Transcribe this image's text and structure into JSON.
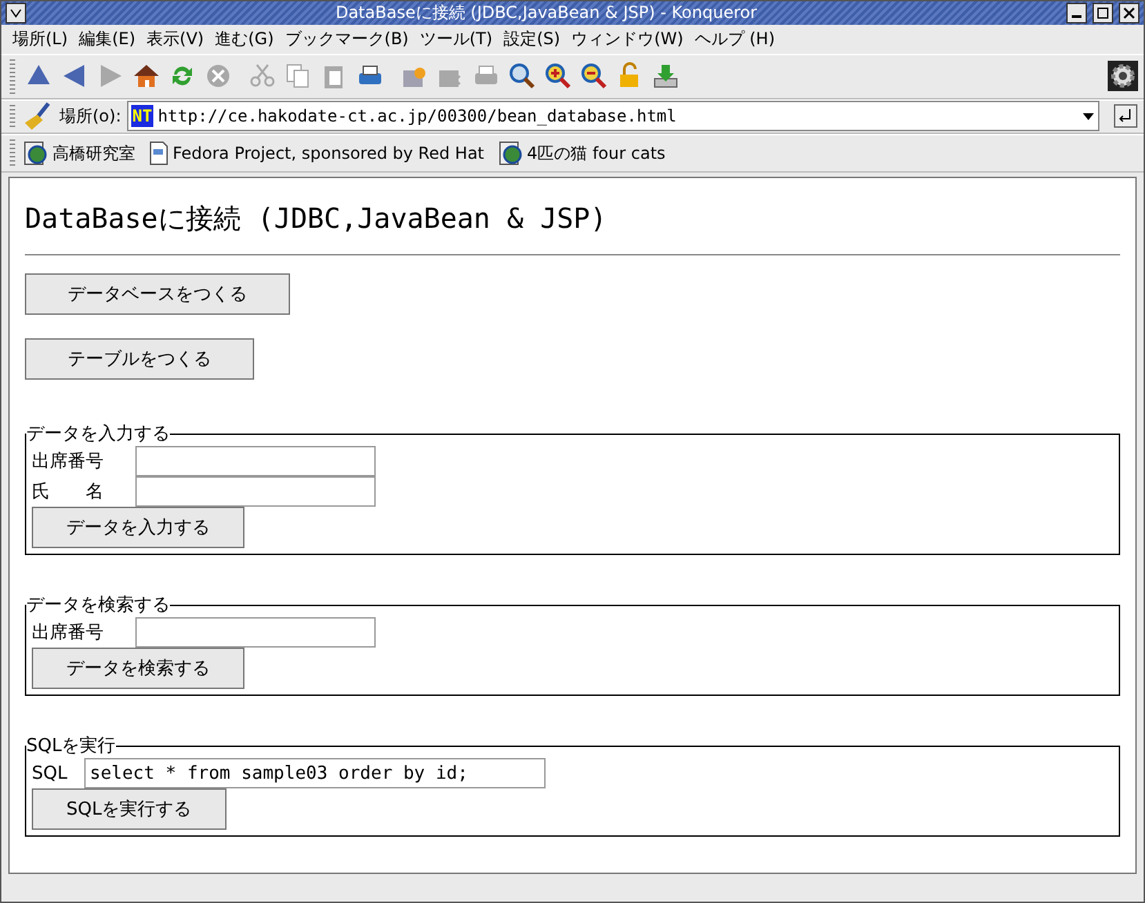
{
  "window": {
    "title": "DataBaseに接続 (JDBC,JavaBean & JSP) - Konqueror"
  },
  "menu": [
    "場所(L)",
    "編集(E)",
    "表示(V)",
    "進む(G)",
    "ブックマーク(B)",
    "ツール(T)",
    "設定(S)",
    "ウィンドウ(W)",
    "ヘルプ (H)"
  ],
  "toolbar": [
    {
      "kind": "up",
      "disabled": false
    },
    {
      "kind": "back",
      "disabled": false
    },
    {
      "kind": "forward",
      "disabled": true
    },
    {
      "kind": "home",
      "disabled": false
    },
    {
      "kind": "reload",
      "disabled": false
    },
    {
      "kind": "stop",
      "disabled": true
    },
    {
      "kind": "cut",
      "disabled": true
    },
    {
      "kind": "copy",
      "disabled": true
    },
    {
      "kind": "paste",
      "disabled": true
    },
    {
      "kind": "print",
      "disabled": false
    },
    {
      "kind": "new-tab",
      "disabled": false
    },
    {
      "kind": "close-tab",
      "disabled": true
    },
    {
      "kind": "printer",
      "disabled": true
    },
    {
      "kind": "find",
      "disabled": false
    },
    {
      "kind": "zoom-in",
      "disabled": false
    },
    {
      "kind": "zoom-out",
      "disabled": false
    },
    {
      "kind": "lock",
      "disabled": false
    },
    {
      "kind": "download",
      "disabled": false
    }
  ],
  "location": {
    "label": "場所(o):",
    "favicon_text": "NT",
    "url": "http://ce.hakodate-ct.ac.jp/00300/bean_database.html"
  },
  "bookmarks": [
    {
      "label": "高橋研究室",
      "kind": "globe"
    },
    {
      "label": "Fedora Project, sponsored by Red Hat",
      "kind": "page"
    },
    {
      "label": "4匹の猫 four cats",
      "kind": "globe"
    }
  ],
  "page": {
    "heading": "DataBaseに接続 (JDBC,JavaBean & JSP)",
    "buttons": [
      {
        "label": "データベースをつくる"
      },
      {
        "label": "テーブルをつくる"
      }
    ],
    "forms": [
      {
        "legend": "データを入力する",
        "fields": [
          {
            "label": "出席番号",
            "kind": "short"
          },
          {
            "label": "氏　　名",
            "kind": "short"
          }
        ],
        "submit": "データを入力する"
      },
      {
        "legend": "データを検索する",
        "fields": [
          {
            "label": "出席番号",
            "kind": "short"
          }
        ],
        "submit": "データを検索する"
      },
      {
        "legend": "SQLを実行",
        "fields": [
          {
            "label": "SQL",
            "value": "select * from sample03 order by id;",
            "kind": "wide"
          }
        ],
        "submit": "SQLを実行する"
      }
    ]
  }
}
